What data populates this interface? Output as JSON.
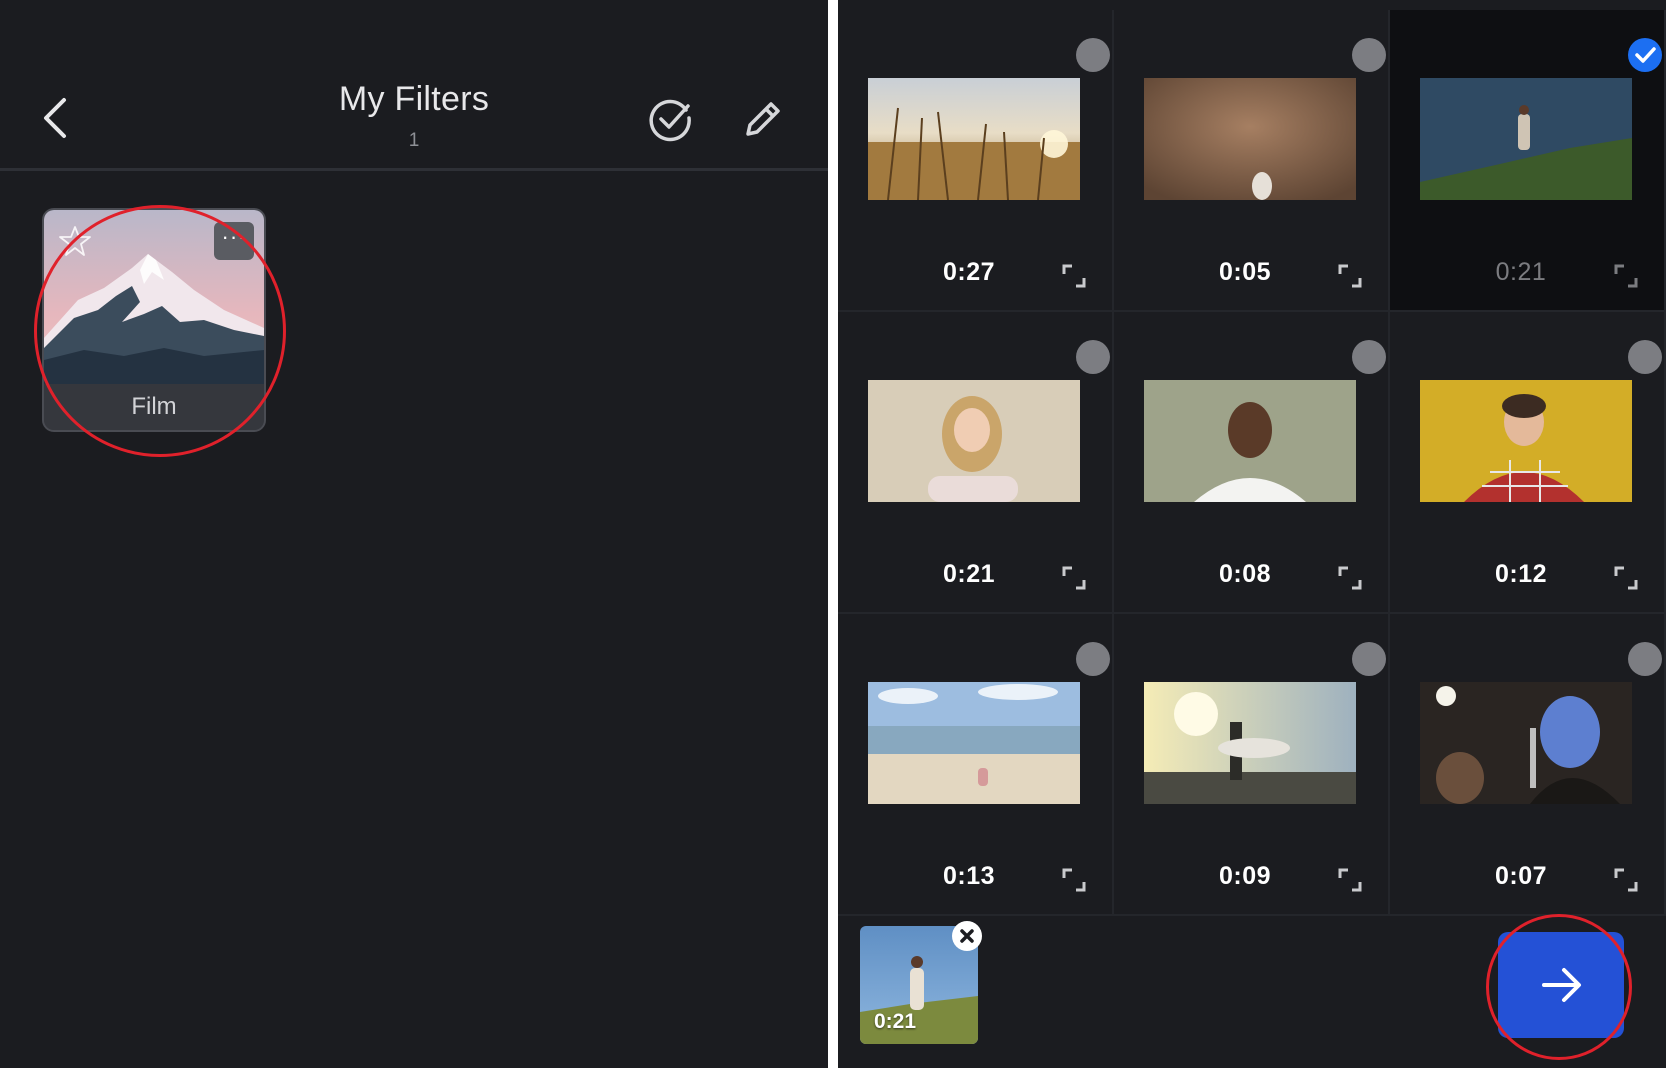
{
  "left_screen": {
    "header": {
      "title": "My Filters",
      "count": "1",
      "back_icon": "chevron-left-icon",
      "select_icon": "check-circle-icon",
      "edit_icon": "pencil-icon"
    },
    "filters": [
      {
        "label": "Film",
        "favorite_icon": "star-outline-icon",
        "more_label": "···",
        "highlighted": true
      }
    ]
  },
  "right_screen": {
    "videos": [
      {
        "duration": "0:27",
        "scene": "field",
        "selected": false
      },
      {
        "duration": "0:05",
        "scene": "sand",
        "selected": false
      },
      {
        "duration": "0:21",
        "scene": "hill",
        "selected": true
      },
      {
        "duration": "0:21",
        "scene": "woman",
        "selected": false
      },
      {
        "duration": "0:08",
        "scene": "man",
        "selected": false
      },
      {
        "duration": "0:12",
        "scene": "yellow",
        "selected": false
      },
      {
        "duration": "0:13",
        "scene": "beach",
        "selected": false
      },
      {
        "duration": "0:09",
        "scene": "surfer",
        "selected": false
      },
      {
        "duration": "0:07",
        "scene": "singer",
        "selected": false
      }
    ],
    "tray": {
      "items": [
        {
          "duration": "0:21"
        }
      ],
      "remove_icon": "close-icon"
    },
    "next_icon": "arrow-right-icon"
  },
  "colors": {
    "background": "#1b1c20",
    "accent": "#1c6ff2",
    "next_button": "#2451d6",
    "highlight_ring": "#e0212b"
  }
}
